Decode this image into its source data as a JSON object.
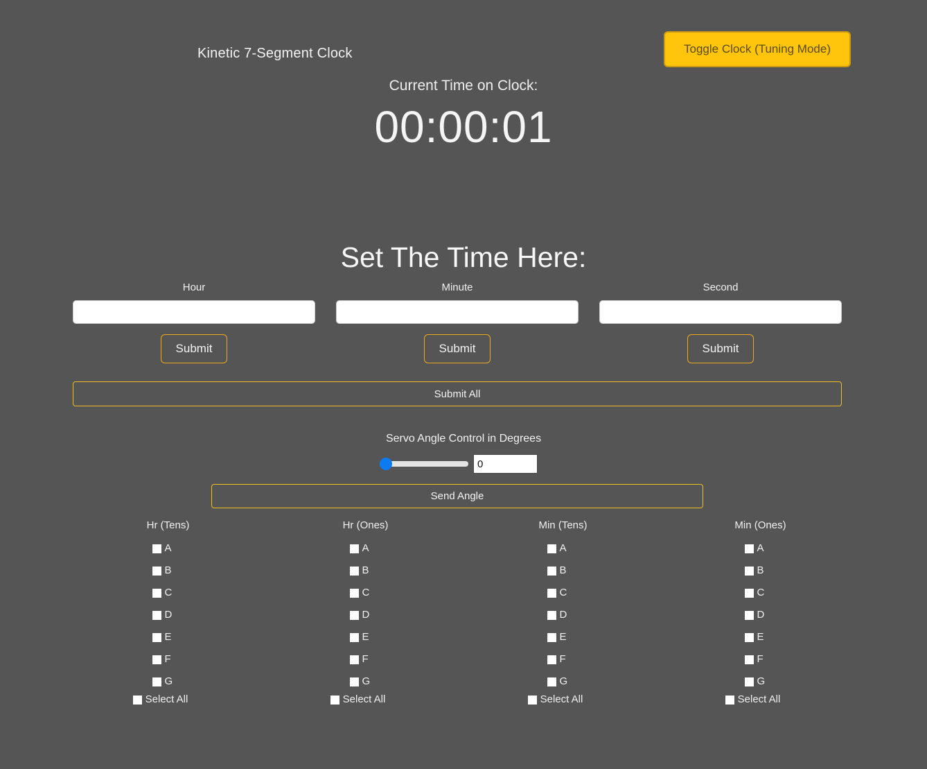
{
  "header": {
    "app_title": "Kinetic 7-Segment Clock",
    "toggle_button": "Toggle Clock (Tuning Mode)"
  },
  "clock": {
    "label": "Current Time on Clock:",
    "value": "00:00:01"
  },
  "set_time": {
    "heading": "Set The Time Here:",
    "fields": [
      {
        "label": "Hour",
        "value": "",
        "placeholder": "",
        "submit_label": "Submit"
      },
      {
        "label": "Minute",
        "value": "",
        "placeholder": "",
        "submit_label": "Submit"
      },
      {
        "label": "Second",
        "value": "",
        "placeholder": "",
        "submit_label": "Submit"
      }
    ],
    "submit_all_label": "Submit All"
  },
  "servo": {
    "label": "Servo Angle Control in Degrees",
    "slider_value": "0",
    "slider_min": "0",
    "slider_max": "180",
    "angle_value": "0",
    "angle_placeholder": "",
    "send_label": "Send Angle"
  },
  "segments": {
    "select_all_label": "Select All",
    "segment_labels": [
      "A",
      "B",
      "C",
      "D",
      "E",
      "F",
      "G"
    ],
    "columns": [
      {
        "title": "Hr (Tens)",
        "checked": [
          false,
          false,
          false,
          false,
          false,
          false,
          false
        ],
        "select_all": false
      },
      {
        "title": "Hr (Ones)",
        "checked": [
          false,
          false,
          false,
          false,
          false,
          false,
          false
        ],
        "select_all": false
      },
      {
        "title": "Min (Tens)",
        "checked": [
          false,
          false,
          false,
          false,
          false,
          false,
          false
        ],
        "select_all": false
      },
      {
        "title": "Min (Ones)",
        "checked": [
          false,
          false,
          false,
          false,
          false,
          false,
          false
        ],
        "select_all": false
      }
    ]
  },
  "colors": {
    "background": "#555555",
    "accent_amber": "#ffc40c",
    "accent_border": "#f0c020",
    "slider_thumb": "#0d7bf0",
    "text": "#f2f2f2"
  }
}
